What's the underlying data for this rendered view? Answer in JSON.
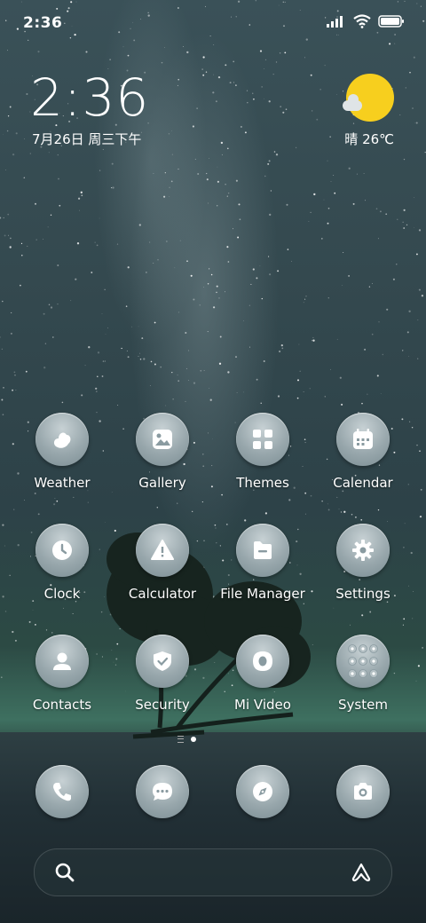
{
  "status_bar": {
    "time": "2:36"
  },
  "clock_widget": {
    "time": "2:36",
    "date": "7月26日 周三下午"
  },
  "weather_widget": {
    "icon": "sunny-cloud-icon",
    "text": "晴 26℃"
  },
  "apps": [
    {
      "label": "Weather",
      "icon": "weather-icon"
    },
    {
      "label": "Gallery",
      "icon": "gallery-icon"
    },
    {
      "label": "Themes",
      "icon": "themes-icon"
    },
    {
      "label": "Calendar",
      "icon": "calendar-icon"
    },
    {
      "label": "Clock",
      "icon": "clock-icon"
    },
    {
      "label": "Calculator",
      "icon": "calculator-icon"
    },
    {
      "label": "File Manager",
      "icon": "file-manager-icon"
    },
    {
      "label": "Settings",
      "icon": "settings-icon"
    },
    {
      "label": "Contacts",
      "icon": "contacts-icon"
    },
    {
      "label": "Security",
      "icon": "security-icon"
    },
    {
      "label": "Mi Video",
      "icon": "mi-video-icon"
    },
    {
      "label": "System",
      "icon": "system-folder-icon"
    }
  ],
  "dock": [
    {
      "icon": "phone-icon"
    },
    {
      "icon": "messages-icon"
    },
    {
      "icon": "browser-icon"
    },
    {
      "icon": "camera-icon"
    }
  ],
  "search_bar": {
    "left_icon": "search-icon",
    "right_icon": "assistant-icon"
  },
  "colors": {
    "sun": "#f7cf1e",
    "icon_bg": "#98a7ac"
  }
}
